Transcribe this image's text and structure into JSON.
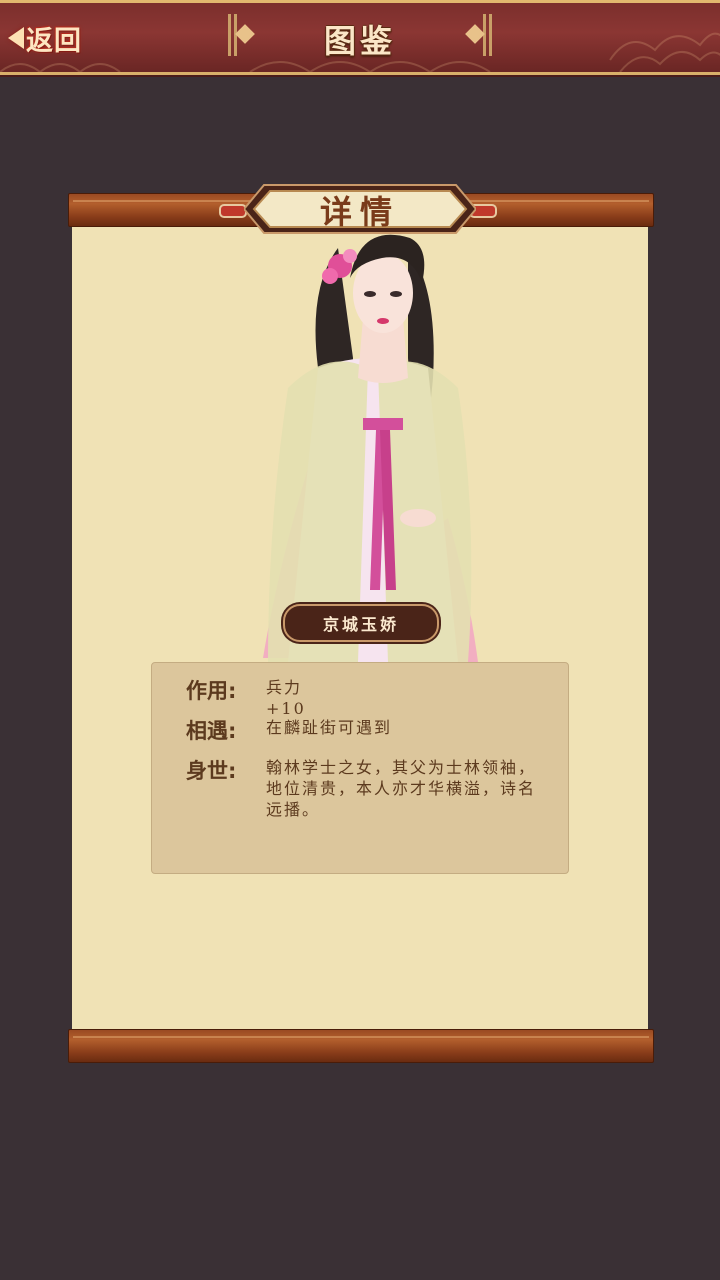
{
  "topbar": {
    "back_label": "返回",
    "title": "图鉴"
  },
  "panel": {
    "header": "详情",
    "character_name": "京城玉娇",
    "info": {
      "effect_label": "作用:",
      "effect_value": "兵力 +10",
      "encounter_label": "相遇:",
      "encounter_value": "在麟趾街可遇到",
      "background_label": "身世:",
      "background_value": "翰林学士之女，其父为士林领袖，地位清贵，本人亦才华横溢，诗名远播。"
    }
  },
  "colors": {
    "topbar": "#7a2e2c",
    "background": "#3a3035",
    "scroll_paper": "#f0e2b5",
    "info_box": "#dcc69c",
    "text": "#5c3a1e"
  }
}
